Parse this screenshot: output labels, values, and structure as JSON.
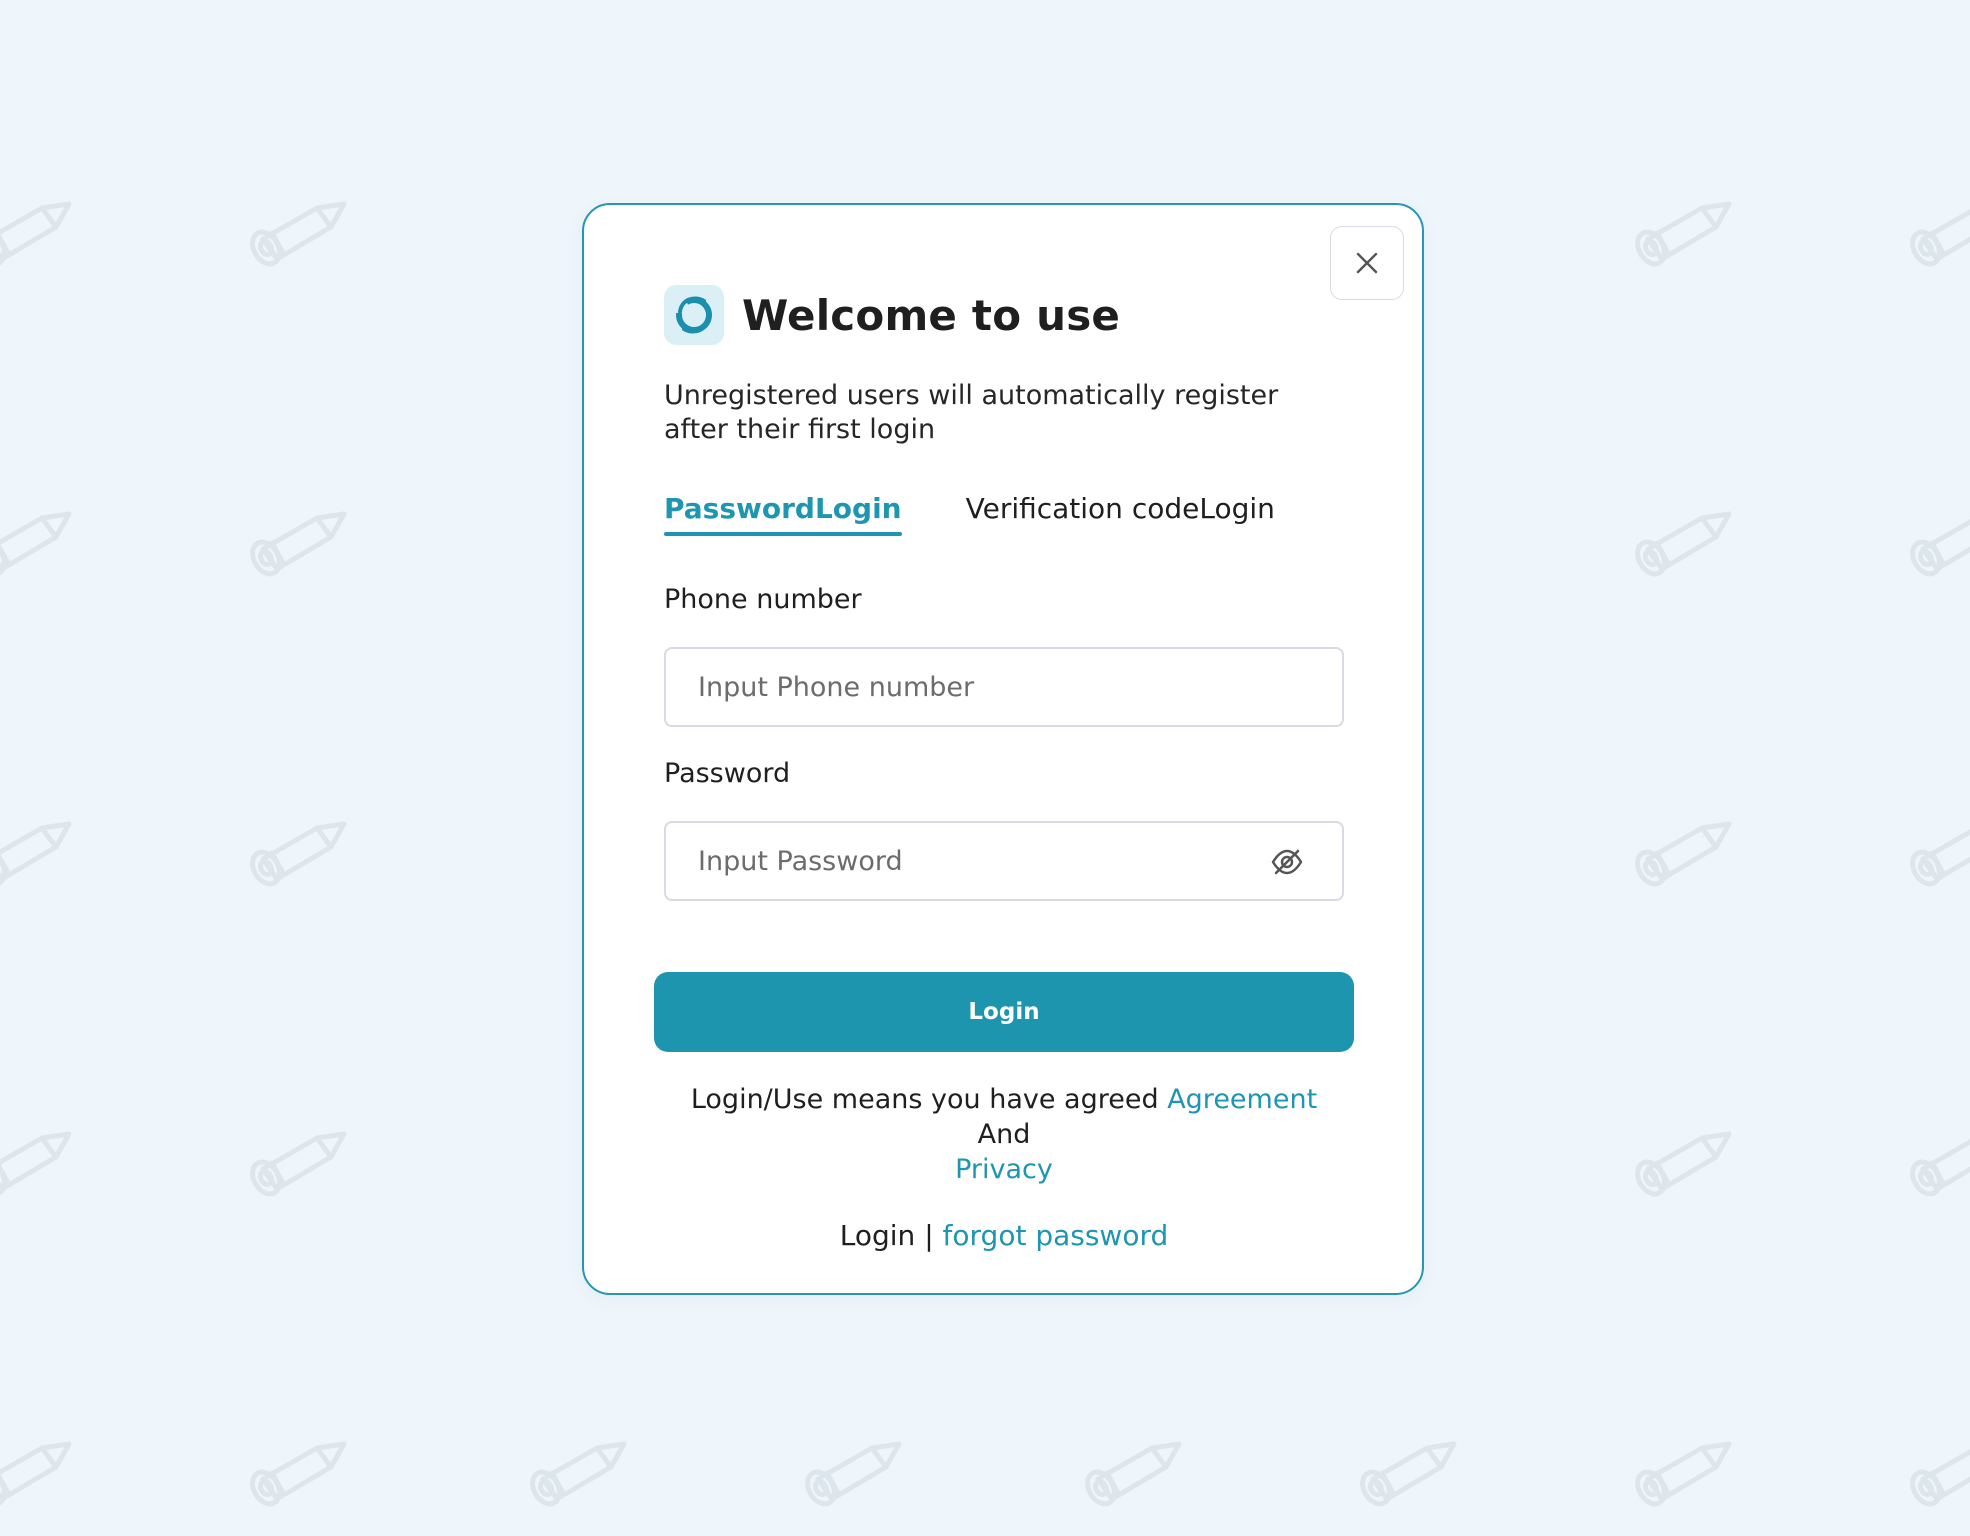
{
  "dialog": {
    "title": "Welcome to use",
    "subtitle": "Unregistered users will automatically register after their first login",
    "tabs": [
      {
        "label": "PasswordLogin",
        "active": true
      },
      {
        "label": "Verification codeLogin",
        "active": false
      }
    ],
    "phone": {
      "label": "Phone number",
      "placeholder": "Input Phone number",
      "value": ""
    },
    "password": {
      "label": "Password",
      "placeholder": "Input Password",
      "value": ""
    },
    "login_button": {
      "label": "Login"
    },
    "agreement": {
      "prefix": "Login/Use means you have agreed",
      "agreement_link": "Agreement",
      "and": "And",
      "privacy_link": "Privacy"
    },
    "footer": {
      "login": "Login",
      "separator": "|",
      "forgot_password": "forgot password"
    }
  },
  "icons": {
    "close": "close-icon",
    "logo": "app-logo-icon",
    "password_visibility": "eye-off-icon",
    "background": "pencil-icon"
  },
  "colors": {
    "accent": "#1F96B1",
    "border": "#2697B3",
    "background": "#EEF6FB",
    "button": "#1D95AE"
  }
}
